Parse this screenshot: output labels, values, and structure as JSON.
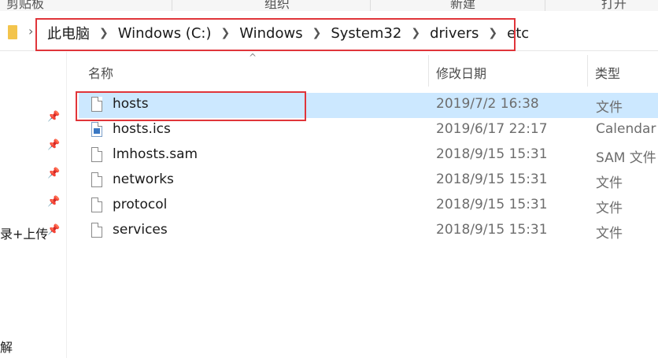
{
  "ribbon": {
    "groups": [
      "剪贴板",
      "组织",
      "新建",
      "打开"
    ]
  },
  "address_bar": {
    "breadcrumbs": [
      "此电脑",
      "Windows (C:)",
      "Windows",
      "System32",
      "drivers",
      "etc"
    ]
  },
  "nav": {
    "items": [
      "录+上传",
      "解"
    ]
  },
  "columns": {
    "name": "名称",
    "date_modified": "修改日期",
    "type": "类型"
  },
  "files": [
    {
      "name": "hosts",
      "date": "2019/7/2 16:38",
      "type": "文件",
      "icon": "file-icon",
      "selected": true
    },
    {
      "name": "hosts.ics",
      "date": "2019/6/17 22:17",
      "type": "Calendar",
      "icon": "calendar-file-icon",
      "selected": false
    },
    {
      "name": "lmhosts.sam",
      "date": "2018/9/15 15:31",
      "type": "SAM 文件",
      "icon": "file-icon",
      "selected": false
    },
    {
      "name": "networks",
      "date": "2018/9/15 15:31",
      "type": "文件",
      "icon": "file-icon",
      "selected": false
    },
    {
      "name": "protocol",
      "date": "2018/9/15 15:31",
      "type": "文件",
      "icon": "file-icon",
      "selected": false
    },
    {
      "name": "services",
      "date": "2018/9/15 15:31",
      "type": "文件",
      "icon": "file-icon",
      "selected": false
    }
  ],
  "colors": {
    "highlight_red": "#e0353a",
    "selection_blue": "#cce8ff",
    "folder_yellow": "#f3c44c"
  }
}
